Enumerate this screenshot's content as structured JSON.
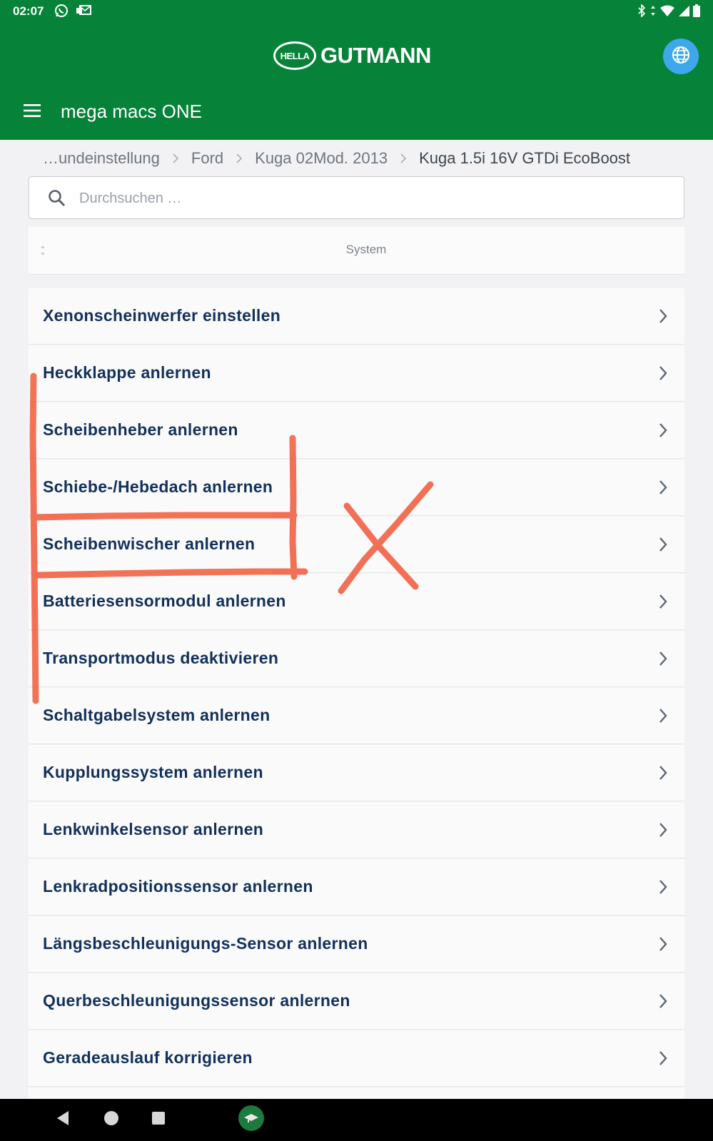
{
  "status_bar": {
    "time": "02:07",
    "left_icons": [
      "whatsapp-icon",
      "mail-icon"
    ],
    "right_icons": [
      "bluetooth-icon",
      "data-arrows-icon",
      "wifi-icon",
      "signal-icon",
      "battery-icon"
    ]
  },
  "header": {
    "logo_oval_text": "HELLA",
    "logo_text": "GUTMANN",
    "title": "mega macs ONE",
    "bg_color": "#068338",
    "globe_color": "#3ea8ea"
  },
  "breadcrumb": {
    "items": [
      "…undeinstellung",
      "Ford",
      "Kuga 02Mod. 2013",
      "Kuga 1.5i 16V GTDi EcoBoost"
    ]
  },
  "search": {
    "placeholder": "Durchsuchen …",
    "value": ""
  },
  "table": {
    "column_header": "System",
    "rows": [
      "Xenonscheinwerfer einstellen",
      "Heckklappe anlernen",
      "Scheibenheber anlernen",
      "Schiebe-/Hebedach anlernen",
      "Scheibenwischer anlernen",
      "Batteriesensormodul anlernen",
      "Transportmodus deaktivieren",
      "Schaltgabelsystem anlernen",
      "Kupplungssystem anlernen",
      "Lenkwinkelsensor anlernen",
      "Lenkradpositionssensor anlernen",
      "Längsbeschleunigungs-Sensor anlernen",
      "Querbeschleunigungssensor anlernen",
      "Geradeauslauf korrigieren"
    ],
    "text_color": "#12315a"
  },
  "annotation": {
    "color": "#f15a3a"
  },
  "nav_bar": {
    "buttons": [
      "back-icon",
      "home-icon",
      "recents-icon",
      "app-shortcut-icon"
    ]
  }
}
